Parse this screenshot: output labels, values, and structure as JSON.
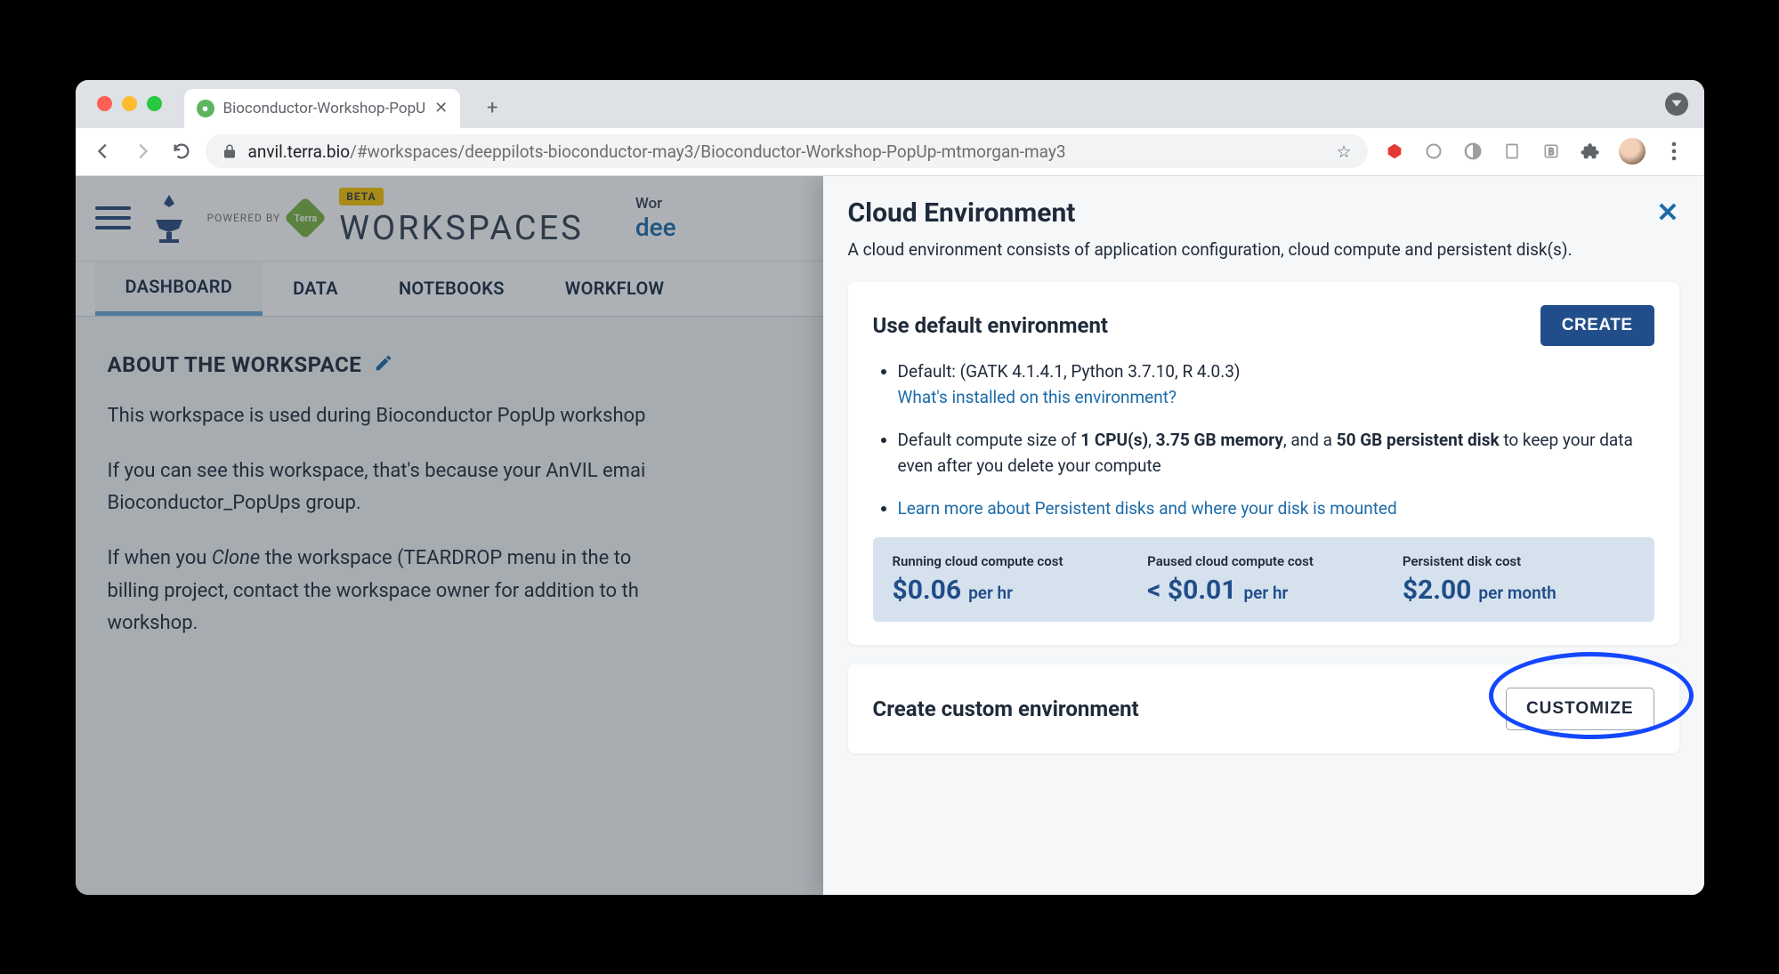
{
  "browser": {
    "tab_title": "Bioconductor-Workshop-PopU",
    "url_host": "anvil.terra.bio",
    "url_path": "/#workspaces/deeppilots-bioconductor-may3/Bioconductor-Workshop-PopUp-mtmorgan-may3"
  },
  "header": {
    "powered_by": "POWERED BY",
    "beta": "BETA",
    "workspaces_title": "WORKSPACES",
    "right_small": "Wor",
    "right_link": "dee"
  },
  "tabs": [
    "DASHBOARD",
    "DATA",
    "NOTEBOOKS",
    "WORKFLOW"
  ],
  "dashboard": {
    "about_title": "ABOUT THE WORKSPACE",
    "p1": "This workspace is used during Bioconductor PopUp workshop",
    "p2": "If you can see this workspace, that's because your AnVIL emai",
    "p2b": "Bioconductor_PopUps group.",
    "p3a": "If when you ",
    "p3_clone": "Clone",
    "p3b": " the workspace (TEARDROP menu in the to",
    "p3c": "billing project, contact the workspace owner for addition to th",
    "p3d": "workshop."
  },
  "panel": {
    "title": "Cloud Environment",
    "subtitle": "A cloud environment consists of application configuration, cloud compute and persistent disk(s).",
    "default_env": {
      "title": "Use default environment",
      "create_btn": "CREATE",
      "li1_prefix": "Default: (GATK 4.1.4.1, Python 3.7.10, R 4.0.3)",
      "li1_link": "What's installed on this environment?",
      "li2_a": "Default compute size of ",
      "li2_cpu": "1 CPU(s)",
      "li2_b": ", ",
      "li2_mem": "3.75 GB memory",
      "li2_c": ", and a ",
      "li2_disk": "50 GB persistent disk",
      "li2_d": " to keep your data even after you delete your compute",
      "li3_link": "Learn more about Persistent disks and where your disk is mounted"
    },
    "costs": {
      "running_label": "Running cloud compute cost",
      "running_value": "$0.06",
      "running_unit": "per hr",
      "paused_label": "Paused cloud compute cost",
      "paused_value": "< $0.01",
      "paused_unit": "per hr",
      "disk_label": "Persistent disk cost",
      "disk_value": "$2.00",
      "disk_unit": "per month"
    },
    "custom": {
      "title": "Create custom environment",
      "customize_btn": "CUSTOMIZE"
    }
  }
}
